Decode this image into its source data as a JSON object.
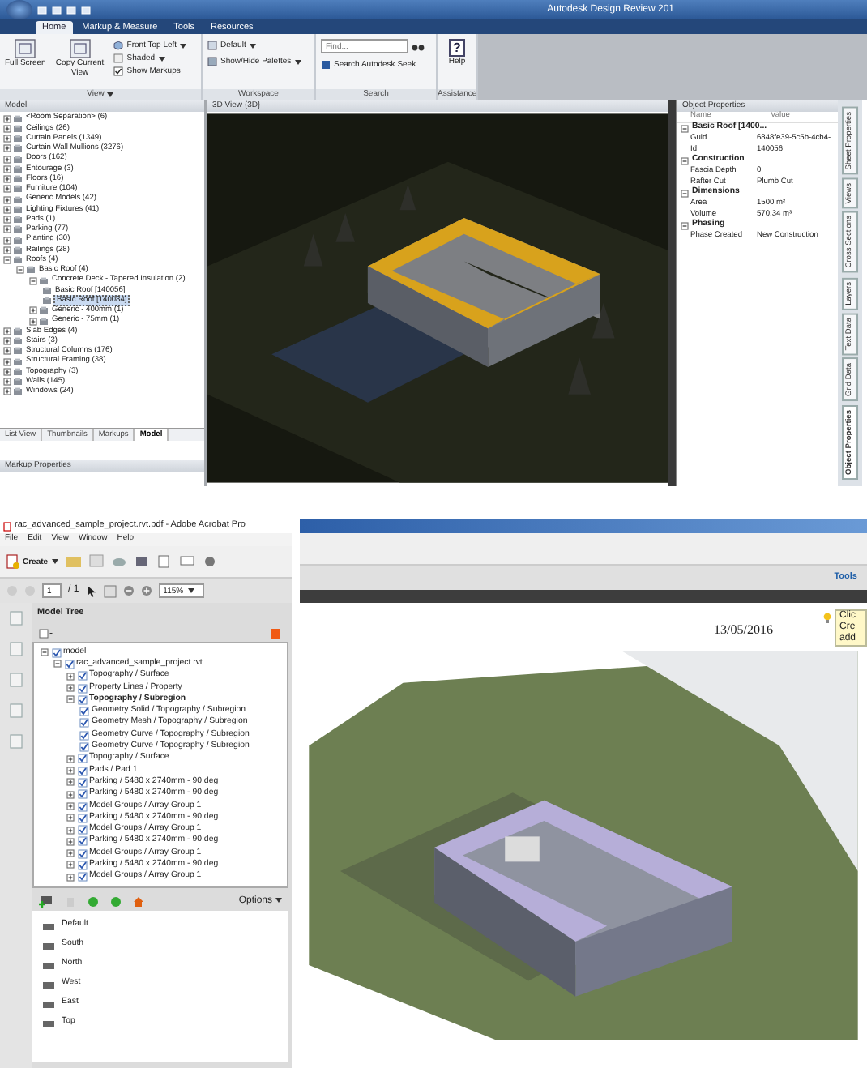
{
  "design_review": {
    "window": {
      "title": "Autodesk Design Review 201"
    },
    "ribbon_tabs": [
      {
        "label": "Home",
        "selected": true
      },
      {
        "label": "Markup & Measure",
        "selected": false
      },
      {
        "label": "Tools",
        "selected": false
      },
      {
        "label": "Resources",
        "selected": false
      }
    ],
    "ribbon": {
      "view": {
        "label": "View",
        "full_screen": "Full Screen",
        "copy_view": "Copy Current View",
        "orientation": "Front Top Left",
        "render_mode": "Shaded",
        "show_markups": {
          "label": "Show Markups",
          "checked": true
        }
      },
      "workspace": {
        "label": "Workspace",
        "default": "Default",
        "palettes": "Show/Hide Palettes"
      },
      "search": {
        "label": "Search",
        "placeholder": "Find...",
        "seek": "Search Autodesk Seek"
      },
      "assistance": {
        "label": "Assistance",
        "help": "Help",
        "help_glyph": "?"
      }
    },
    "model_panel": {
      "title": "Model",
      "tree": [
        {
          "label": "<Room Separation> (6)",
          "expanded": false,
          "selected": false
        },
        {
          "label": "Ceilings (26)",
          "expanded": false,
          "selected": false
        },
        {
          "label": "Curtain Panels (1349)",
          "expanded": false,
          "selected": false
        },
        {
          "label": "Curtain Wall Mullions (3276)",
          "expanded": false,
          "selected": false
        },
        {
          "label": "Doors (162)",
          "expanded": false,
          "selected": false
        },
        {
          "label": "Entourage (3)",
          "expanded": false,
          "selected": false
        },
        {
          "label": "Floors (16)",
          "expanded": false,
          "selected": false
        },
        {
          "label": "Furniture (104)",
          "expanded": false,
          "selected": false
        },
        {
          "label": "Generic Models (42)",
          "expanded": false,
          "selected": false
        },
        {
          "label": "Lighting Fixtures (41)",
          "expanded": false,
          "selected": false
        },
        {
          "label": "Pads (1)",
          "expanded": false,
          "selected": false
        },
        {
          "label": "Parking (77)",
          "expanded": false,
          "selected": false
        },
        {
          "label": "Planting (30)",
          "expanded": false,
          "selected": false
        },
        {
          "label": "Railings (28)",
          "expanded": false,
          "selected": false
        },
        {
          "label": "Roofs (4)",
          "expanded": true,
          "selected": false,
          "children": [
            {
              "label": "Basic Roof (4)",
              "expanded": true,
              "selected": false,
              "children": [
                {
                  "label": "Concrete Deck - Tapered Insulation (2)",
                  "expanded": true,
                  "selected": false,
                  "children": [
                    {
                      "label": "Basic Roof [140056]",
                      "selected": false
                    },
                    {
                      "label": "Basic Roof [140084]",
                      "selected": true
                    }
                  ]
                },
                {
                  "label": "Generic - 400mm (1)",
                  "expanded": false,
                  "selected": false
                },
                {
                  "label": "Generic - 75mm (1)",
                  "expanded": false,
                  "selected": false
                }
              ]
            }
          ]
        },
        {
          "label": "Slab Edges (4)",
          "expanded": false,
          "selected": false
        },
        {
          "label": "Stairs (3)",
          "expanded": false,
          "selected": false
        },
        {
          "label": "Structural Columns (176)",
          "expanded": false,
          "selected": false
        },
        {
          "label": "Structural Framing (38)",
          "expanded": false,
          "selected": false
        },
        {
          "label": "Topography (3)",
          "expanded": false,
          "selected": false
        },
        {
          "label": "Walls (145)",
          "expanded": false,
          "selected": false
        },
        {
          "label": "Windows (24)",
          "expanded": false,
          "selected": false
        }
      ],
      "tabs": [
        {
          "label": "List View",
          "selected": false
        },
        {
          "label": "Thumbnails",
          "selected": false
        },
        {
          "label": "Markups",
          "selected": false
        },
        {
          "label": "Model",
          "selected": true
        }
      ],
      "markup_title": "Markup Properties"
    },
    "view": {
      "title": "3D View {3D}"
    },
    "properties": {
      "title": "Object Properties",
      "columns": [
        "Name",
        "Value"
      ],
      "groups": [
        {
          "label": "Basic Roof [1400...",
          "expanded": true,
          "rows": [
            {
              "name": "Guid",
              "value": "6848fe39-5c5b-4cb4-"
            },
            {
              "name": "Id",
              "value": "140056"
            }
          ]
        },
        {
          "label": "Construction",
          "expanded": true,
          "rows": [
            {
              "name": "Fascia Depth",
              "value": "0"
            },
            {
              "name": "Rafter Cut",
              "value": "Plumb Cut"
            }
          ]
        },
        {
          "label": "Dimensions",
          "expanded": true,
          "rows": [
            {
              "name": "Area",
              "value": "1500 m²"
            },
            {
              "name": "Volume",
              "value": "570.34 m³"
            }
          ]
        },
        {
          "label": "Phasing",
          "expanded": true,
          "rows": [
            {
              "name": "Phase Created",
              "value": "New Construction"
            }
          ]
        }
      ]
    },
    "side_tabs": [
      {
        "label": "Sheet Properties",
        "selected": false
      },
      {
        "label": "Views",
        "selected": false
      },
      {
        "label": "Cross Sections",
        "selected": false
      },
      {
        "label": "Layers",
        "selected": false
      },
      {
        "label": "Text Data",
        "selected": false
      },
      {
        "label": "Grid Data",
        "selected": false
      },
      {
        "label": "Object Properties",
        "selected": true
      }
    ]
  },
  "acrobat": {
    "window": {
      "title": "rac_advanced_sample_project.rvt.pdf - Adobe Acrobat Pro"
    },
    "menu": [
      "File",
      "Edit",
      "View",
      "Window",
      "Help"
    ],
    "create": "Create",
    "page": "1",
    "page_count": "/ 1",
    "zoom": "115%",
    "tools": "Tools",
    "model_tree": {
      "title": "Model Tree",
      "tree": [
        {
          "label": "model",
          "checked": true,
          "expanded": true,
          "children": [
            {
              "label": "rac_advanced_sample_project.rvt",
              "checked": true,
              "expanded": true,
              "children": [
                {
                  "label": "Topography / Surface",
                  "checked": true,
                  "expanded": false
                },
                {
                  "label": "Property Lines / Property",
                  "checked": true,
                  "expanded": false
                },
                {
                  "label": "Topography / Subregion",
                  "checked": true,
                  "expanded": true,
                  "children": [
                    {
                      "label": "Geometry Solid / Topography / Subregion",
                      "checked": true
                    },
                    {
                      "label": "Geometry Mesh / Topography / Subregion",
                      "checked": true
                    },
                    {
                      "label": "Geometry Curve / Topography / Subregion",
                      "checked": true
                    },
                    {
                      "label": "Geometry Curve / Topography / Subregion",
                      "checked": true
                    }
                  ]
                },
                {
                  "label": "Topography / Surface",
                  "checked": true,
                  "expanded": false
                },
                {
                  "label": "Pads / Pad 1",
                  "checked": true,
                  "expanded": false
                },
                {
                  "label": "Parking / 5480 x 2740mm - 90 deg",
                  "checked": true,
                  "expanded": false
                },
                {
                  "label": "Parking / 5480 x 2740mm - 90 deg",
                  "checked": true,
                  "expanded": false
                },
                {
                  "label": "Model Groups / Array Group 1",
                  "checked": true,
                  "expanded": false
                },
                {
                  "label": "Parking / 5480 x 2740mm - 90 deg",
                  "checked": true,
                  "expanded": false
                },
                {
                  "label": "Model Groups / Array Group 1",
                  "checked": true,
                  "expanded": false
                },
                {
                  "label": "Parking / 5480 x 2740mm - 90 deg",
                  "checked": true,
                  "expanded": false
                },
                {
                  "label": "Model Groups / Array Group 1",
                  "checked": true,
                  "expanded": false
                },
                {
                  "label": "Parking / 5480 x 2740mm - 90 deg",
                  "checked": true,
                  "expanded": false
                },
                {
                  "label": "Model Groups / Array Group 1",
                  "checked": true,
                  "expanded": false
                }
              ]
            }
          ]
        }
      ]
    },
    "views": {
      "options": "Options",
      "items": [
        "Default",
        "South",
        "North",
        "West",
        "East",
        "Top"
      ]
    },
    "document": {
      "date": "13/05/2016"
    },
    "hint_popup": {
      "lines": [
        "Clic",
        "Cre",
        "add"
      ]
    }
  }
}
